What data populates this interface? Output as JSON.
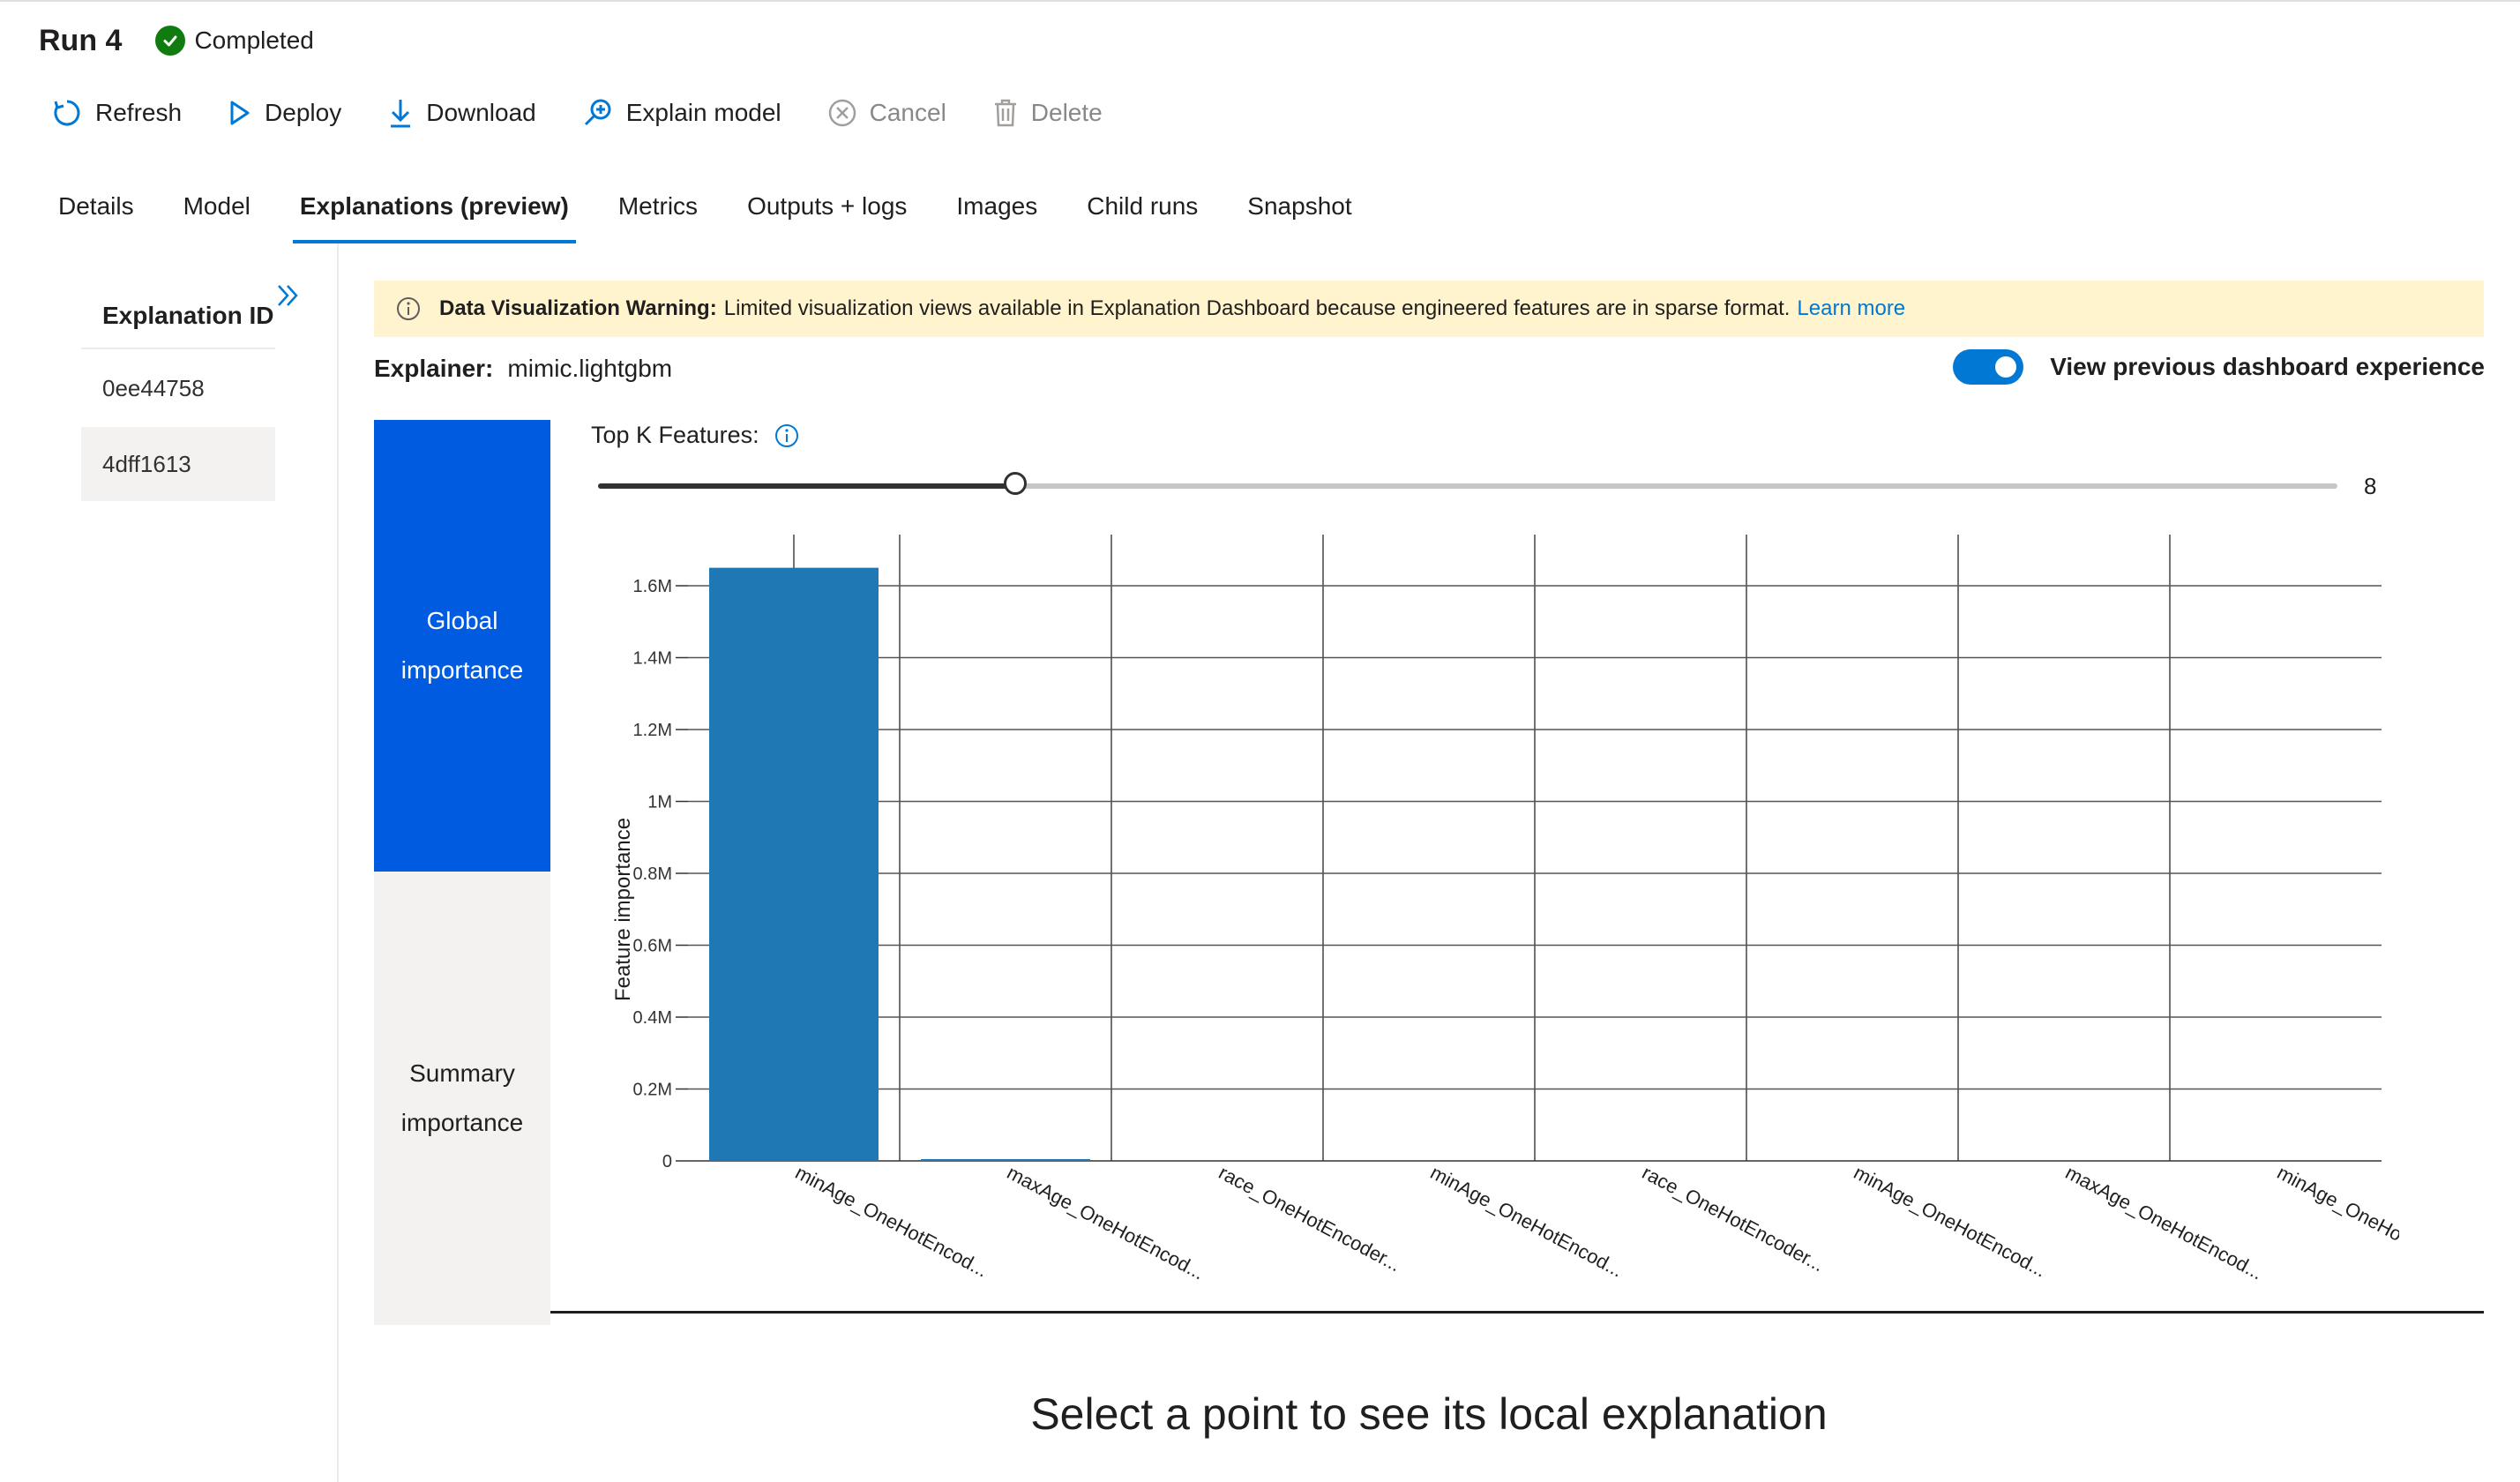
{
  "header": {
    "title": "Run 4",
    "status": "Completed",
    "status_color": "#107c10"
  },
  "toolbar": {
    "refresh": "Refresh",
    "deploy": "Deploy",
    "download": "Download",
    "explain": "Explain model",
    "cancel": "Cancel",
    "delete": "Delete"
  },
  "tabs": [
    "Details",
    "Model",
    "Explanations (preview)",
    "Metrics",
    "Outputs + logs",
    "Images",
    "Child runs",
    "Snapshot"
  ],
  "active_tab": "Explanations (preview)",
  "sidebar": {
    "header": "Explanation ID",
    "items": [
      "0ee44758",
      "4dff1613"
    ],
    "selected": "4dff1613"
  },
  "warning": {
    "bold": "Data Visualization Warning:",
    "text": "Limited visualization views available in Explanation Dashboard because engineered features are in sparse format.",
    "link": "Learn more"
  },
  "explainer": {
    "label": "Explainer:",
    "value": "mimic.lightgbm"
  },
  "toggle": {
    "label": "View previous dashboard experience",
    "on": true
  },
  "importance_tabs": {
    "global_line1": "Global",
    "global_line2": "importance",
    "summary_line1": "Summary",
    "summary_line2": "importance"
  },
  "topk": {
    "label": "Top K Features:",
    "value": "8",
    "fraction": 0.24
  },
  "chart_data": {
    "type": "bar",
    "ylabel": "Feature importance",
    "xlabel": "",
    "ylim": [
      0,
      1.7
    ],
    "yticks": [
      "0",
      "0.2M",
      "0.4M",
      "0.6M",
      "0.8M",
      "1M",
      "1.2M",
      "1.4M",
      "1.6M"
    ],
    "categories": [
      "minAge_OneHotEncod...",
      "maxAge_OneHotEncod...",
      "race_OneHotEncoder...",
      "minAge_OneHotEncod...",
      "race_OneHotEncoder...",
      "minAge_OneHotEncod...",
      "maxAge_OneHotEncod...",
      "minAge_OneHotEncod..."
    ],
    "values": [
      1.65,
      0.005,
      0.001,
      0.001,
      0.001,
      0.001,
      0.001,
      0.001
    ],
    "bar_color": "#1f77b4",
    "grid": true
  },
  "local_message": "Select a point to see its local explanation"
}
